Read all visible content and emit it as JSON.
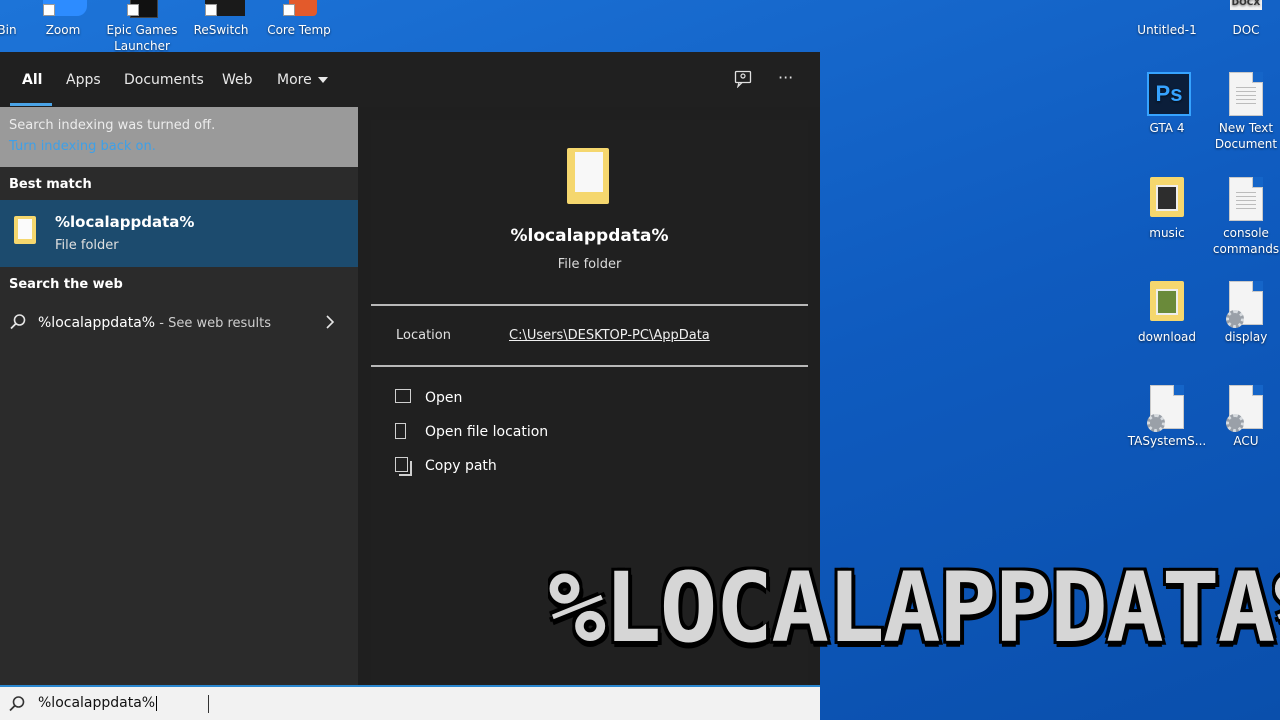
{
  "desktop": {
    "top_icons": [
      {
        "label": "Bin"
      },
      {
        "label": "Zoom"
      },
      {
        "label": "Epic Games Launcher"
      },
      {
        "label": "ReSwitch"
      },
      {
        "label": "Core Temp"
      }
    ],
    "right_icons": [
      {
        "label": "Untitled-1"
      },
      {
        "label": "DOC",
        "badge": "DOCX"
      },
      {
        "label": "GTA 4",
        "glyph": "Ps"
      },
      {
        "label": "New Text Document"
      },
      {
        "label": "music"
      },
      {
        "label": "console commands"
      },
      {
        "label": "download"
      },
      {
        "label": "display"
      },
      {
        "label": "TASystemS..."
      },
      {
        "label": "ACU"
      }
    ]
  },
  "tabs": {
    "all": "All",
    "apps": "Apps",
    "documents": "Documents",
    "web": "Web",
    "more": "More"
  },
  "notice": {
    "line1": "Search indexing was turned off.",
    "link": "Turn indexing back on."
  },
  "best_match": {
    "heading": "Best match",
    "title": "%localappdata%",
    "type": "File folder"
  },
  "web_search": {
    "heading": "Search the web",
    "query": "%localappdata%",
    "suffix": " - See web results"
  },
  "preview": {
    "title": "%localappdata%",
    "type": "File folder",
    "location_label": "Location",
    "location_value": "C:\\Users\\DESKTOP-PC\\AppData",
    "actions": [
      {
        "label": "Open",
        "icon": "open-icon"
      },
      {
        "label": "Open file location",
        "icon": "file-location-icon"
      },
      {
        "label": "Copy path",
        "icon": "copy-icon"
      }
    ]
  },
  "search": {
    "value": "%localappdata%"
  },
  "overlay": {
    "text": "%LOCALAPPDATA%"
  },
  "colors": {
    "desktop_blue": "#1266cc",
    "panel_dark": "#1f1f1f",
    "selected": "#1c4b6e",
    "accent": "#4aa3e6",
    "link": "#4aa3e6"
  }
}
